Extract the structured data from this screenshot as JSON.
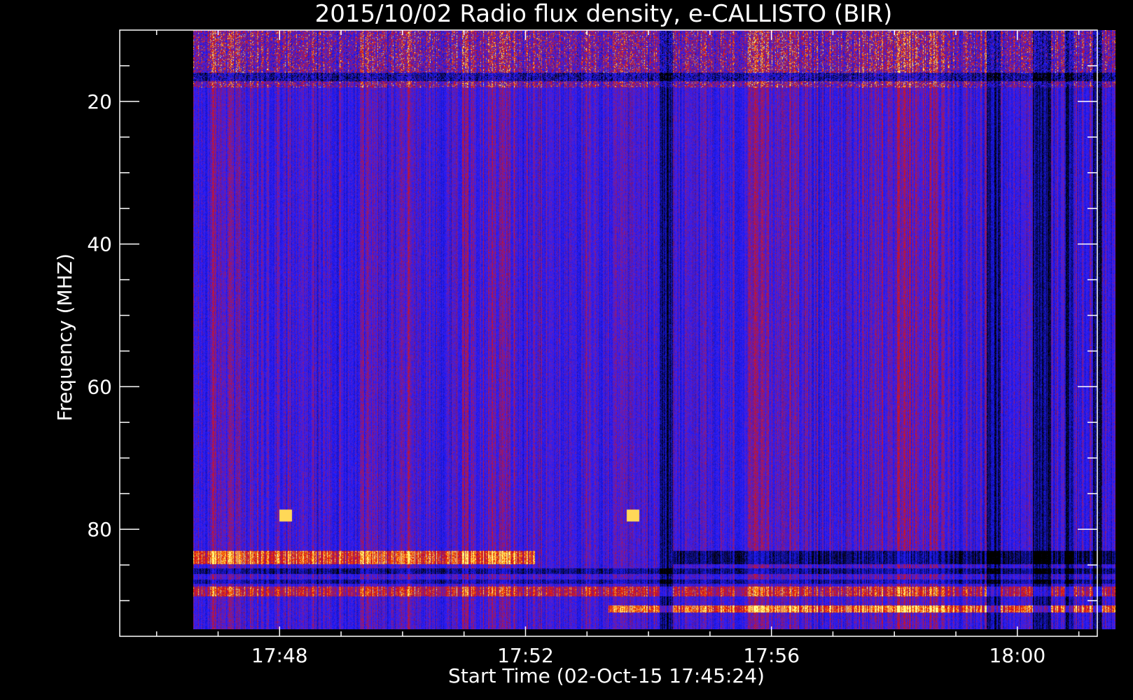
{
  "chart_data": {
    "type": "heatmap",
    "title": "2015/10/02  Radio flux density, e-CALLISTO (BIR)",
    "xlabel": "Start Time (02-Oct-15 17:45:24)",
    "ylabel": "Frequency (MHZ)",
    "x_range_minutes": [
      "17:45:24",
      "18:01:18"
    ],
    "y_range_mhz": [
      10,
      95
    ],
    "y_inverted": true,
    "x_ticks": [
      {
        "label": "17:48",
        "minutes": 1068
      },
      {
        "label": "17:52",
        "minutes": 1072
      },
      {
        "label": "17:56",
        "minutes": 1076
      },
      {
        "label": "18:00",
        "minutes": 1080
      }
    ],
    "y_ticks": [
      {
        "label": "20",
        "mhz": 20
      },
      {
        "label": "40",
        "mhz": 40
      },
      {
        "label": "60",
        "mhz": 60
      },
      {
        "label": "80",
        "mhz": 80
      }
    ],
    "data_extent": {
      "t_start": 1066.6,
      "t_end": 1081.6,
      "f_low": 94,
      "f_high": 10
    },
    "colormap": [
      "#000000",
      "#1a1aff",
      "#4a2ad8",
      "#9a1a7a",
      "#d01010",
      "#ff8a00",
      "#ffff80"
    ],
    "features": [
      {
        "kind": "band",
        "description_freq_mhz": [
          10,
          18
        ],
        "level": "high"
      },
      {
        "kind": "band",
        "description_freq_mhz": [
          83,
          84.5
        ],
        "level": "high",
        "t": [
          1066.6,
          1072.0
        ]
      },
      {
        "kind": "band",
        "description_freq_mhz": [
          90.5,
          91.5
        ],
        "level": "high",
        "t": [
          1072.0,
          1081.6
        ]
      },
      {
        "kind": "burst",
        "freq_mhz": 78,
        "time_min": 1068.1
      },
      {
        "kind": "burst",
        "freq_mhz": 78,
        "time_min": 1073.75
      }
    ]
  }
}
